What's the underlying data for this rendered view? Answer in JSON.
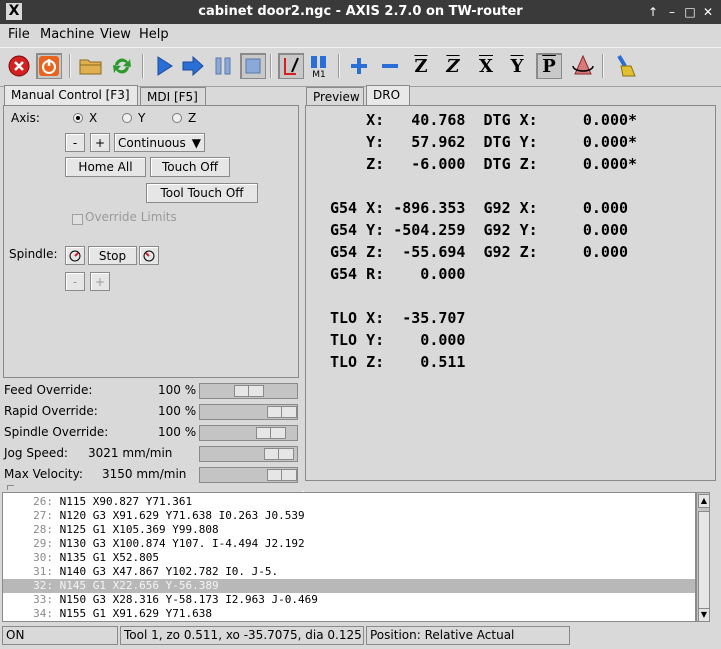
{
  "window": {
    "title": "cabinet door2.ngc - AXIS 2.7.0 on TW-router",
    "logo": "X",
    "buttons": [
      "↑",
      "–",
      "□",
      "✕"
    ]
  },
  "menu": [
    {
      "label": "File"
    },
    {
      "label": "Machine"
    },
    {
      "label": "View"
    },
    {
      "label": "Help"
    }
  ],
  "toolbar": {
    "icons": [
      "estop-icon",
      "power-icon",
      "open-file-icon",
      "reload-icon",
      "run-icon",
      "step-icon",
      "pause-icon",
      "stop-icon",
      "block-delete-icon",
      "optional-stop-icon",
      "zoom-in-icon",
      "zoom-out-icon",
      "view-z-icon",
      "view-z2-icon",
      "view-x-icon",
      "view-y-icon",
      "view-p-icon",
      "rotate-view-icon",
      "clear-plot-icon"
    ],
    "view_letters": [
      "Z",
      "Z",
      "X",
      "Y",
      "P"
    ],
    "m1_label": "M1"
  },
  "left_tabs": [
    {
      "label": "Manual Control [F3]"
    },
    {
      "label": "MDI [F5]"
    }
  ],
  "right_tabs": [
    {
      "label": "Preview"
    },
    {
      "label": "DRO"
    }
  ],
  "manual": {
    "axis_label": "Axis:",
    "axes": [
      "X",
      "Y",
      "Z"
    ],
    "selected_axis": "X",
    "minus": "-",
    "plus": "+",
    "jog_mode": "Continuous",
    "home_all": "Home All",
    "touch_off": "Touch Off",
    "tool_touch_off": "Tool Touch Off",
    "override_limits": "Override Limits",
    "spindle_label": "Spindle:",
    "spindle_stop": "Stop"
  },
  "overrides": [
    {
      "label": "Feed Override:",
      "value": "100 %",
      "fraction": 0.5
    },
    {
      "label": "Rapid Override:",
      "value": "100 %",
      "fraction": 1.0
    },
    {
      "label": "Spindle Override:",
      "value": "100 %",
      "fraction": 0.83
    },
    {
      "label": "Jog Speed:",
      "value": "3021 mm/min",
      "fraction": 0.96
    },
    {
      "label": "Max Velocity:",
      "value": "3150 mm/min",
      "fraction": 1.0
    }
  ],
  "dro": {
    "lines": [
      "    X:   40.768  DTG X:     0.000*",
      "    Y:   57.962  DTG Y:     0.000*",
      "    Z:   -6.000  DTG Z:     0.000*",
      "",
      "G54 X: -896.353  G92 X:     0.000",
      "G54 Y: -504.259  G92 Y:     0.000",
      "G54 Z:  -55.694  G92 Z:     0.000",
      "G54 R:    0.000",
      "",
      "TLO X:  -35.707",
      "TLO Y:    0.000",
      "TLO Z:    0.511"
    ]
  },
  "gcode": {
    "selected_line": 32,
    "lines": [
      {
        "n": "26:",
        "text": "N115 X90.827 Y71.361"
      },
      {
        "n": "27:",
        "text": "N120 G3 X91.629 Y71.638 I0.263 J0.539"
      },
      {
        "n": "28:",
        "text": "N125 G1 X105.369 Y99.808"
      },
      {
        "n": "29:",
        "text": "N130 G3 X100.874 Y107. I-4.494 J2.192"
      },
      {
        "n": "30:",
        "text": "N135 G1 X52.805"
      },
      {
        "n": "31:",
        "text": "N140 G3 X47.867 Y102.782 I0. J-5."
      },
      {
        "n": "32:",
        "text": "N145 G1 X22.656 Y-56.389"
      },
      {
        "n": "33:",
        "text": "N150 G3 X28.316 Y-58.173 I2.963 J-0.469"
      },
      {
        "n": "34:",
        "text": "N155 G1 X91.629 Y71.638"
      }
    ]
  },
  "statusbar": {
    "state": "ON",
    "tool": "Tool 1, zo 0.511, xo -35.7075, dia 0.125",
    "position": "Position: Relative Actual"
  },
  "colors": {
    "estop": "#d42020",
    "power": "#e8641e",
    "run": "#2a6fd6",
    "reload": "#2a9a2a"
  }
}
